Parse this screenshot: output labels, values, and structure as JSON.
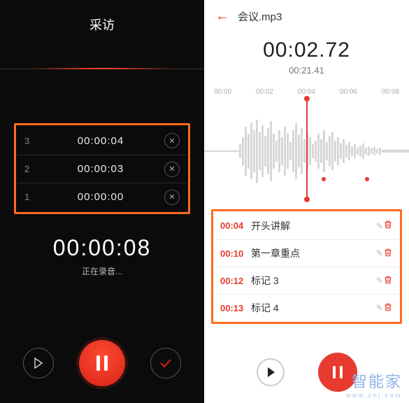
{
  "recorder": {
    "title": "采访",
    "marks": [
      {
        "index": "3",
        "time": "00:00:04"
      },
      {
        "index": "2",
        "time": "00:00:03"
      },
      {
        "index": "1",
        "time": "00:00:00"
      }
    ],
    "elapsed": "00:00:08",
    "status": "正在录音..."
  },
  "player": {
    "filename": "会议.mp3",
    "current_time": "00:02.72",
    "total_time": "00:21.41",
    "axis": [
      "00:00",
      "00:02",
      "00:04",
      "00:06",
      "00:08"
    ],
    "bookmarks": [
      {
        "t": "00:04",
        "label": "开头讲解"
      },
      {
        "t": "00:10",
        "label": "第一章重点"
      },
      {
        "t": "00:12",
        "label": "标记 3"
      },
      {
        "t": "00:13",
        "label": "标记 4"
      }
    ]
  },
  "watermark": {
    "brand": "智能家",
    "url": "www.znj.com"
  }
}
